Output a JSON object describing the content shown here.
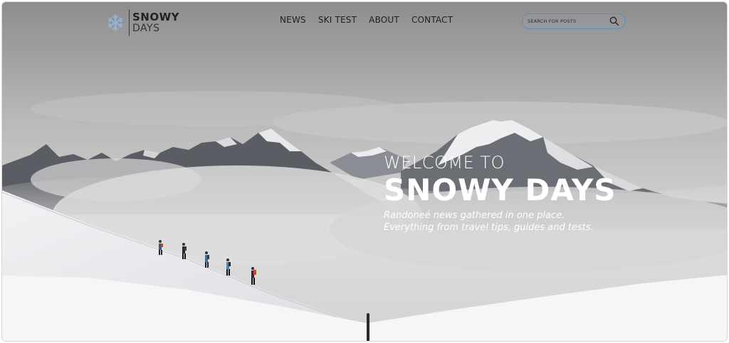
{
  "brand": {
    "name_line1": "SNOWY",
    "name_line2": "DAYS",
    "icon": "snowflake-icon"
  },
  "nav": {
    "items": [
      {
        "label": "NEWS"
      },
      {
        "label": "SKI TEST"
      },
      {
        "label": "ABOUT"
      },
      {
        "label": "CONTACT"
      }
    ]
  },
  "search": {
    "placeholder": "SEARCH FOR POSTS",
    "icon": "search-icon"
  },
  "hero": {
    "welcome": "WELCOME TO",
    "title": "SNOWY DAYS",
    "tagline_line1": "Randoneé news gathered in one place.",
    "tagline_line2": "Everything from travel tips, guides and tests."
  },
  "colors": {
    "search_border": "#5a8fb8",
    "snowflake": "#8fb4d6",
    "hero_text": "#ffffff"
  }
}
